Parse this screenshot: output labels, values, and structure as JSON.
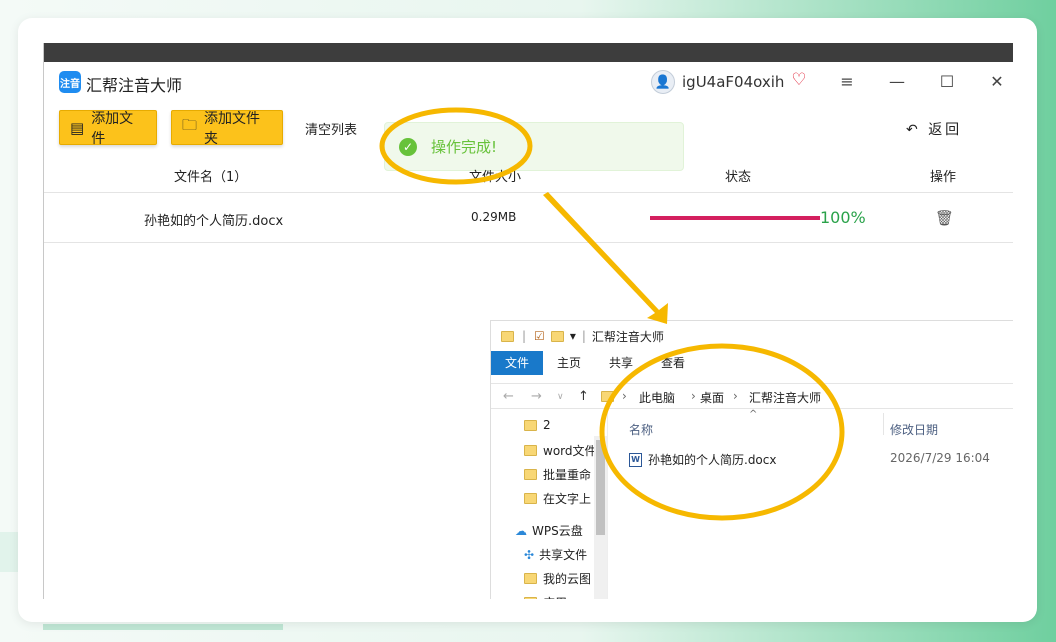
{
  "app": {
    "title": "汇帮注音大师",
    "logo_text": "注音",
    "username": "igU4aF04oxih"
  },
  "window_controls": {
    "menu": "≡",
    "minimize": "—",
    "maximize": "☐",
    "close": "✕"
  },
  "toolbar": {
    "add_file": "添加文件",
    "add_folder": "添加文件夹",
    "clear_list": "清空列表",
    "back": "返回"
  },
  "toast": {
    "message": "操作完成!"
  },
  "table": {
    "headers": {
      "filename": "文件名（1）",
      "size": "文件大小",
      "status": "状态",
      "action": "操作"
    },
    "rows": [
      {
        "filename": "孙艳如的个人简历.docx",
        "size": "0.29MB",
        "progress": 1.0,
        "progress_text": "100%"
      }
    ]
  },
  "explorer": {
    "title": "汇帮注音大师",
    "ribbon_tabs": [
      "文件",
      "主页",
      "共享",
      "查看"
    ],
    "breadcrumb": [
      "此电脑",
      "桌面",
      "汇帮注音大师"
    ],
    "tree": [
      "2",
      "word文件",
      "批量重命",
      "在文字上",
      "WPS云盘",
      "共享文件",
      "我的云图",
      "应用"
    ],
    "columns": {
      "name": "名称",
      "modified": "修改日期"
    },
    "file": {
      "name": "孙艳如的个人简历.docx",
      "modified": "2026/7/29 16:04"
    }
  },
  "colors": {
    "accent_yellow": "#fcc21b",
    "progress": "#d4205f",
    "percent_green": "#2aa24a",
    "toast_green": "#67c23a",
    "annotation": "#f6b800",
    "explorer_tab_blue": "#1979ca"
  }
}
